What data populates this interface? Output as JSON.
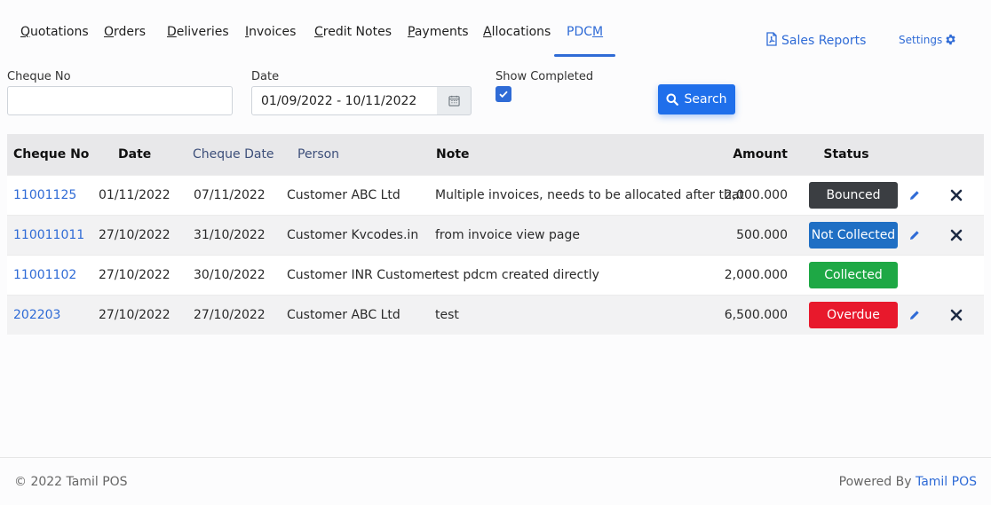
{
  "tabs": [
    {
      "first": "Q",
      "rest": "uotations"
    },
    {
      "first": "O",
      "rest": "rders"
    },
    {
      "first": "D",
      "rest": "eliveries"
    },
    {
      "first": "I",
      "rest": "nvoices"
    },
    {
      "first": "C",
      "rest": "redit Notes"
    },
    {
      "first": "P",
      "rest": "ayments"
    },
    {
      "first": "A",
      "rest": "llocations"
    },
    {
      "pre": "PDC",
      "first": "M",
      "active": true
    }
  ],
  "header": {
    "sales_reports": "Sales Reports",
    "settings": "Settings"
  },
  "filters": {
    "cheque_no_label": "Cheque No",
    "cheque_no_value": "",
    "date_label": "Date",
    "date_value": "01/09/2022 - 10/11/2022",
    "show_completed_label": "Show Completed",
    "show_completed_checked": true,
    "search_label": "Search"
  },
  "table": {
    "columns": [
      "Cheque No",
      "Date",
      "Cheque Date",
      "Person",
      "Note",
      "Amount",
      "Status"
    ],
    "rows": [
      {
        "cheque_no": "11001125",
        "date": "01/11/2022",
        "cheque_date": "07/11/2022",
        "person": "Customer ABC Ltd",
        "note": "Multiple invoices, needs to be allocated after that",
        "amount": "2,000.000",
        "status": "Bounced",
        "status_color": "#3b3e42",
        "actions": true
      },
      {
        "cheque_no": "110011011",
        "date": "27/10/2022",
        "cheque_date": "31/10/2022",
        "person": "Customer Kvcodes.in",
        "note": "from invoice view page",
        "amount": "500.000",
        "status": "Not Collected",
        "status_color": "#1f6fc4",
        "actions": true
      },
      {
        "cheque_no": "11001102",
        "date": "27/10/2022",
        "cheque_date": "30/10/2022",
        "person": "Customer INR Customer",
        "note": "test pdcm created directly",
        "amount": "2,000.000",
        "status": "Collected",
        "status_color": "#1ea845",
        "actions": false
      },
      {
        "cheque_no": "202203",
        "date": "27/10/2022",
        "cheque_date": "27/10/2022",
        "person": "Customer ABC Ltd",
        "note": "test",
        "amount": "6,500.000",
        "status": "Overdue",
        "status_color": "#e8192c",
        "actions": true
      }
    ]
  },
  "footer": {
    "copyright": "© 2022 Tamil POS",
    "powered_by": "Powered By",
    "powered_link": "Tamil POS"
  },
  "colors": {
    "accent": "#2f6bd6",
    "header_bg": "#e8e8ea"
  }
}
